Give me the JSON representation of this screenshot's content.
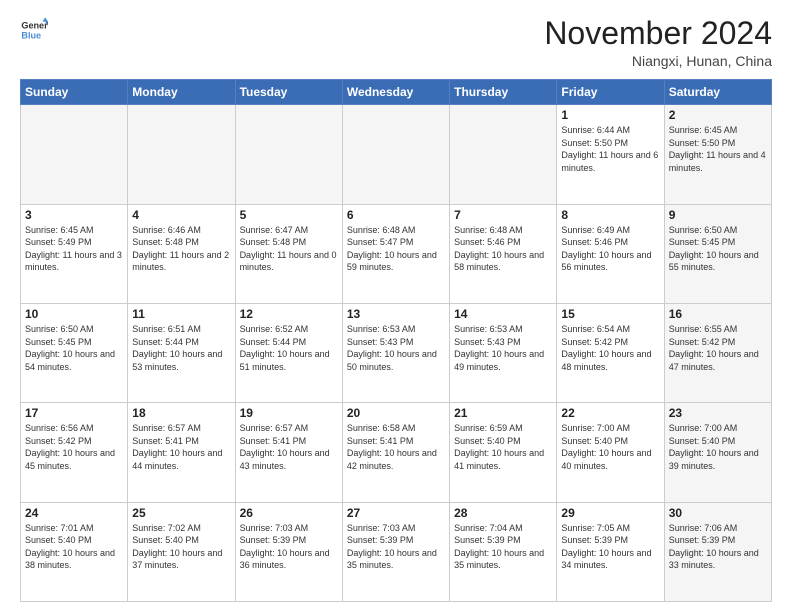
{
  "logo": {
    "line1": "General",
    "line2": "Blue"
  },
  "title": "November 2024",
  "location": "Niangxi, Hunan, China",
  "days_of_week": [
    "Sunday",
    "Monday",
    "Tuesday",
    "Wednesday",
    "Thursday",
    "Friday",
    "Saturday"
  ],
  "weeks": [
    [
      {
        "day": "",
        "info": ""
      },
      {
        "day": "",
        "info": ""
      },
      {
        "day": "",
        "info": ""
      },
      {
        "day": "",
        "info": ""
      },
      {
        "day": "",
        "info": ""
      },
      {
        "day": "1",
        "info": "Sunrise: 6:44 AM\nSunset: 5:50 PM\nDaylight: 11 hours and 6 minutes."
      },
      {
        "day": "2",
        "info": "Sunrise: 6:45 AM\nSunset: 5:50 PM\nDaylight: 11 hours and 4 minutes."
      }
    ],
    [
      {
        "day": "3",
        "info": "Sunrise: 6:45 AM\nSunset: 5:49 PM\nDaylight: 11 hours and 3 minutes."
      },
      {
        "day": "4",
        "info": "Sunrise: 6:46 AM\nSunset: 5:48 PM\nDaylight: 11 hours and 2 minutes."
      },
      {
        "day": "5",
        "info": "Sunrise: 6:47 AM\nSunset: 5:48 PM\nDaylight: 11 hours and 0 minutes."
      },
      {
        "day": "6",
        "info": "Sunrise: 6:48 AM\nSunset: 5:47 PM\nDaylight: 10 hours and 59 minutes."
      },
      {
        "day": "7",
        "info": "Sunrise: 6:48 AM\nSunset: 5:46 PM\nDaylight: 10 hours and 58 minutes."
      },
      {
        "day": "8",
        "info": "Sunrise: 6:49 AM\nSunset: 5:46 PM\nDaylight: 10 hours and 56 minutes."
      },
      {
        "day": "9",
        "info": "Sunrise: 6:50 AM\nSunset: 5:45 PM\nDaylight: 10 hours and 55 minutes."
      }
    ],
    [
      {
        "day": "10",
        "info": "Sunrise: 6:50 AM\nSunset: 5:45 PM\nDaylight: 10 hours and 54 minutes."
      },
      {
        "day": "11",
        "info": "Sunrise: 6:51 AM\nSunset: 5:44 PM\nDaylight: 10 hours and 53 minutes."
      },
      {
        "day": "12",
        "info": "Sunrise: 6:52 AM\nSunset: 5:44 PM\nDaylight: 10 hours and 51 minutes."
      },
      {
        "day": "13",
        "info": "Sunrise: 6:53 AM\nSunset: 5:43 PM\nDaylight: 10 hours and 50 minutes."
      },
      {
        "day": "14",
        "info": "Sunrise: 6:53 AM\nSunset: 5:43 PM\nDaylight: 10 hours and 49 minutes."
      },
      {
        "day": "15",
        "info": "Sunrise: 6:54 AM\nSunset: 5:42 PM\nDaylight: 10 hours and 48 minutes."
      },
      {
        "day": "16",
        "info": "Sunrise: 6:55 AM\nSunset: 5:42 PM\nDaylight: 10 hours and 47 minutes."
      }
    ],
    [
      {
        "day": "17",
        "info": "Sunrise: 6:56 AM\nSunset: 5:42 PM\nDaylight: 10 hours and 45 minutes."
      },
      {
        "day": "18",
        "info": "Sunrise: 6:57 AM\nSunset: 5:41 PM\nDaylight: 10 hours and 44 minutes."
      },
      {
        "day": "19",
        "info": "Sunrise: 6:57 AM\nSunset: 5:41 PM\nDaylight: 10 hours and 43 minutes."
      },
      {
        "day": "20",
        "info": "Sunrise: 6:58 AM\nSunset: 5:41 PM\nDaylight: 10 hours and 42 minutes."
      },
      {
        "day": "21",
        "info": "Sunrise: 6:59 AM\nSunset: 5:40 PM\nDaylight: 10 hours and 41 minutes."
      },
      {
        "day": "22",
        "info": "Sunrise: 7:00 AM\nSunset: 5:40 PM\nDaylight: 10 hours and 40 minutes."
      },
      {
        "day": "23",
        "info": "Sunrise: 7:00 AM\nSunset: 5:40 PM\nDaylight: 10 hours and 39 minutes."
      }
    ],
    [
      {
        "day": "24",
        "info": "Sunrise: 7:01 AM\nSunset: 5:40 PM\nDaylight: 10 hours and 38 minutes."
      },
      {
        "day": "25",
        "info": "Sunrise: 7:02 AM\nSunset: 5:40 PM\nDaylight: 10 hours and 37 minutes."
      },
      {
        "day": "26",
        "info": "Sunrise: 7:03 AM\nSunset: 5:39 PM\nDaylight: 10 hours and 36 minutes."
      },
      {
        "day": "27",
        "info": "Sunrise: 7:03 AM\nSunset: 5:39 PM\nDaylight: 10 hours and 35 minutes."
      },
      {
        "day": "28",
        "info": "Sunrise: 7:04 AM\nSunset: 5:39 PM\nDaylight: 10 hours and 35 minutes."
      },
      {
        "day": "29",
        "info": "Sunrise: 7:05 AM\nSunset: 5:39 PM\nDaylight: 10 hours and 34 minutes."
      },
      {
        "day": "30",
        "info": "Sunrise: 7:06 AM\nSunset: 5:39 PM\nDaylight: 10 hours and 33 minutes."
      }
    ]
  ]
}
